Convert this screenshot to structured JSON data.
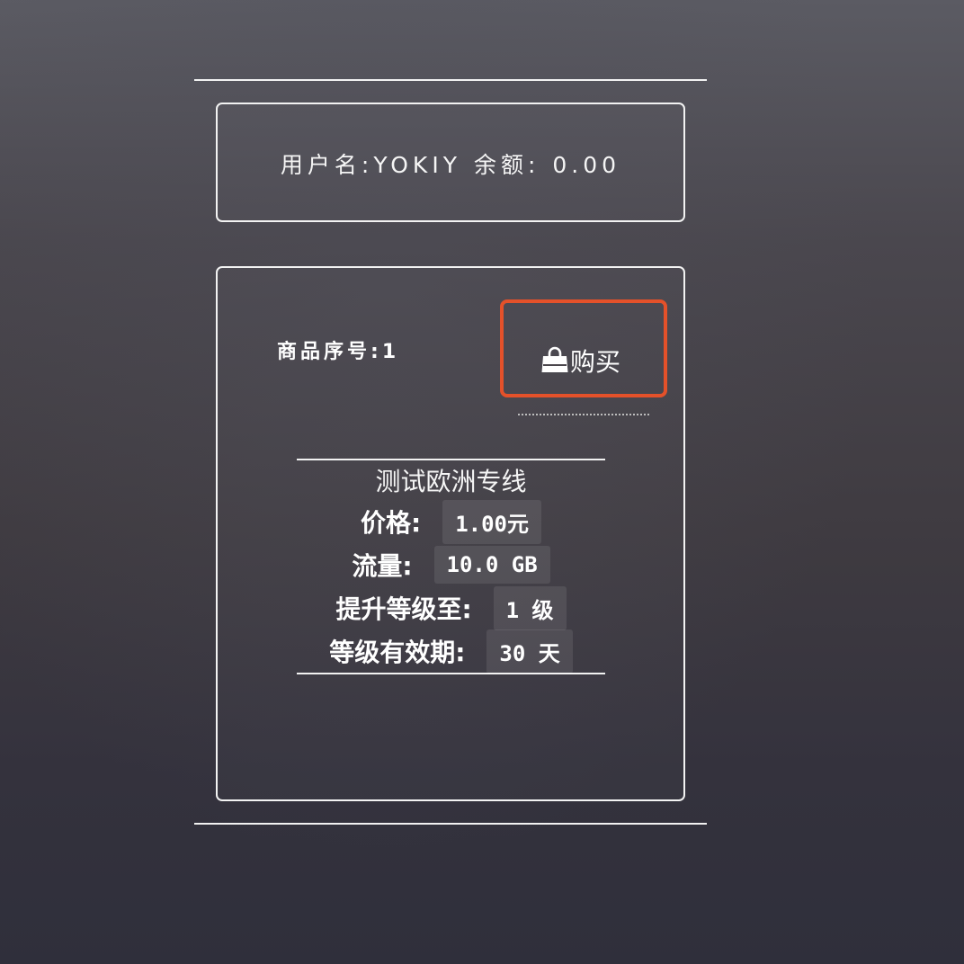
{
  "user": {
    "username_label": "用户名:",
    "username": "YOKIY",
    "balance_label": "余额:",
    "balance": "0.00"
  },
  "product": {
    "serial_label": "商品序号:",
    "serial": "1",
    "buy_label": "购买",
    "buy_icon": "shopping-bag-icon",
    "accent_color": "#e4512a",
    "name": "测试欧洲专线",
    "fields": [
      {
        "label": "价格:",
        "value": "1.00元"
      },
      {
        "label": "流量:",
        "value": "10.0 GB"
      },
      {
        "label": "提升等级至:",
        "value": "1 级"
      },
      {
        "label": "等级有效期:",
        "value": "30 天"
      }
    ]
  }
}
